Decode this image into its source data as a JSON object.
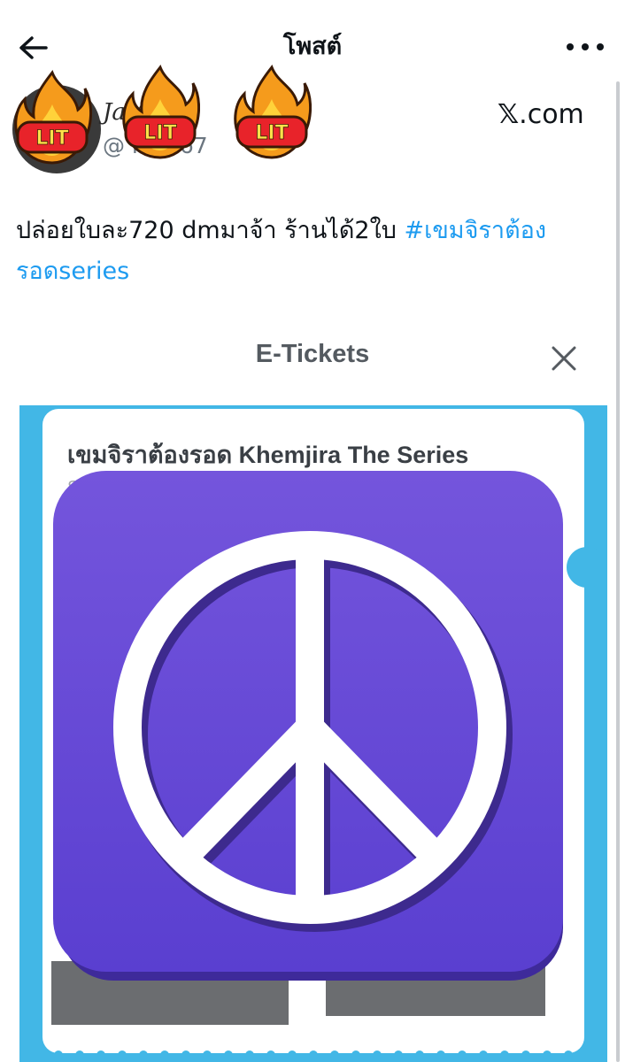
{
  "header": {
    "title": "โพสต์"
  },
  "author": {
    "display_name_visible": "Ja       A",
    "handle_visible": "@          hav      67",
    "sticker_text": "LIT",
    "source_prefix": "𝕏",
    "source_suffix": ".com"
  },
  "tweet": {
    "text": "ปล่อยใบละ720 dmมาจ้า ร้านได้2ใบ ",
    "hashtag": "#เขมจิราต้องรอดseries",
    "hashtag_color": "#1d9bf0"
  },
  "ticket": {
    "screen_title": "E-Tickets",
    "event_name": "เขมจิราต้องรอด Khemjira The Series",
    "sub_visible": "SE",
    "frame_color": "#42b7e6"
  },
  "sticker": {
    "icon": "peace-icon",
    "color": "#6a4fd6"
  },
  "icons": {
    "back": "arrow-left-icon",
    "more": "more-horizontal-icon",
    "close": "close-icon"
  }
}
